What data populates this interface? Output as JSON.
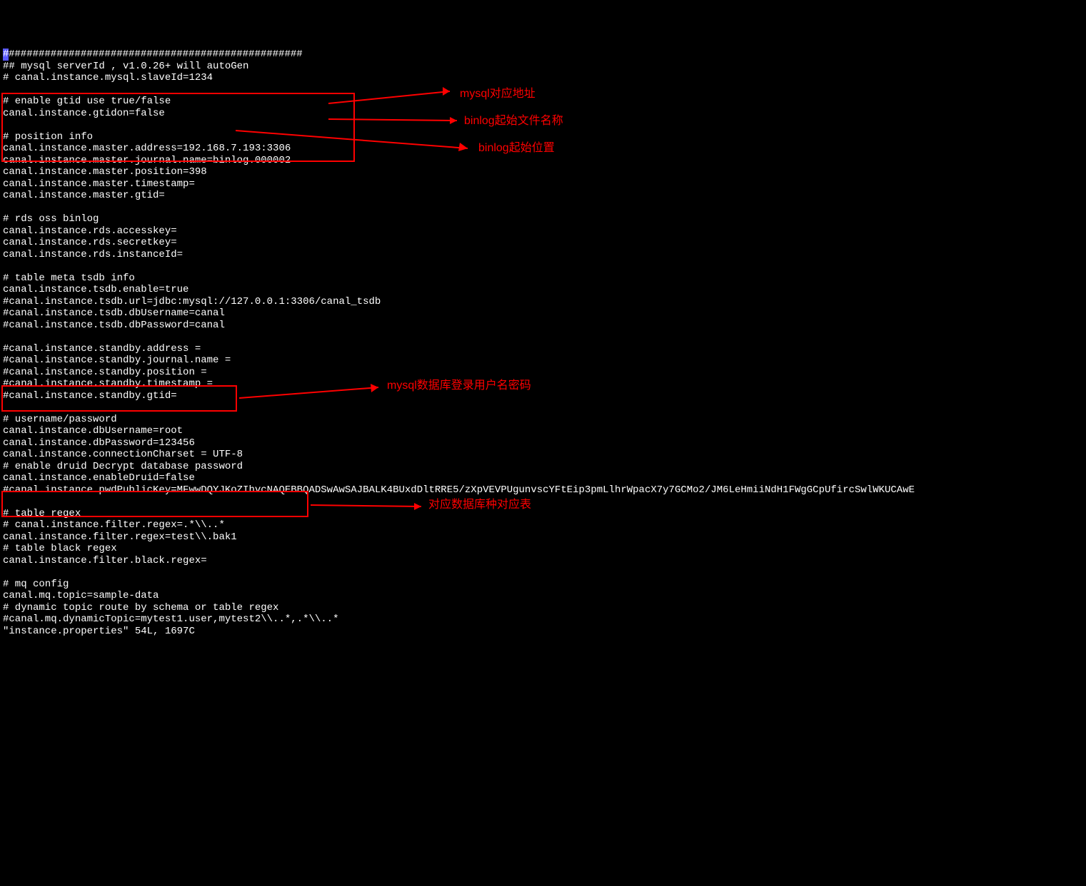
{
  "lines": [
    "#################################################",
    "## mysql serverId , v1.0.26+ will autoGen",
    "# canal.instance.mysql.slaveId=1234",
    "",
    "# enable gtid use true/false",
    "canal.instance.gtidon=false",
    "",
    "# position info",
    "canal.instance.master.address=192.168.7.193:3306",
    "canal.instance.master.journal.name=binlog.000002",
    "canal.instance.master.position=398",
    "canal.instance.master.timestamp=",
    "canal.instance.master.gtid=",
    "",
    "# rds oss binlog",
    "canal.instance.rds.accesskey=",
    "canal.instance.rds.secretkey=",
    "canal.instance.rds.instanceId=",
    "",
    "# table meta tsdb info",
    "canal.instance.tsdb.enable=true",
    "#canal.instance.tsdb.url=jdbc:mysql://127.0.0.1:3306/canal_tsdb",
    "#canal.instance.tsdb.dbUsername=canal",
    "#canal.instance.tsdb.dbPassword=canal",
    "",
    "#canal.instance.standby.address =",
    "#canal.instance.standby.journal.name =",
    "#canal.instance.standby.position =",
    "#canal.instance.standby.timestamp =",
    "#canal.instance.standby.gtid=",
    "",
    "# username/password",
    "canal.instance.dbUsername=root",
    "canal.instance.dbPassword=123456",
    "canal.instance.connectionCharset = UTF-8",
    "# enable druid Decrypt database password",
    "canal.instance.enableDruid=false",
    "#canal.instance.pwdPublicKey=MFwwDQYJKoZIhvcNAQEBBQADSwAwSAJBALK4BUxdDltRRE5/zXpVEVPUgunvscYFtEip3pmLlhrWpacX7y7GCMo2/JM6LeHmiiNdH1FWgGCpUfircSwlWKUCAwE",
    "",
    "# table regex",
    "# canal.instance.filter.regex=.*\\\\..*",
    "canal.instance.filter.regex=test\\\\.bak1",
    "# table black regex",
    "canal.instance.filter.black.regex=",
    "",
    "# mq config",
    "canal.mq.topic=sample-data",
    "# dynamic topic route by schema or table regex",
    "#canal.mq.dynamicTopic=mytest1.user,mytest2\\\\..*,.*\\\\..*",
    "\"instance.properties\" 54L, 1697C"
  ],
  "annotations": {
    "a1": "mysql对应地址",
    "a2": "binlog起始文件名称",
    "a3": "binlog起始位置",
    "a4": "mysql数据库登录用户名密码",
    "a5": "对应数据库种对应表"
  },
  "config_values": {
    "gtidon": "false",
    "master_address": "192.168.7.193:3306",
    "master_journal_name": "binlog.000002",
    "master_position": "398",
    "tsdb_enable": "true",
    "tsdb_url": "jdbc:mysql://127.0.0.1:3306/canal_tsdb",
    "dbUsername": "root",
    "dbPassword": "123456",
    "connectionCharset": "UTF-8",
    "enableDruid": "false",
    "filter_regex": "test\\\\.bak1",
    "mq_topic": "sample-data",
    "file_status": "\"instance.properties\" 54L, 1697C"
  },
  "colors": {
    "bg": "#000000",
    "fg": "#ffffff",
    "cursor": "#5858ff",
    "annotation": "#ff0000"
  }
}
